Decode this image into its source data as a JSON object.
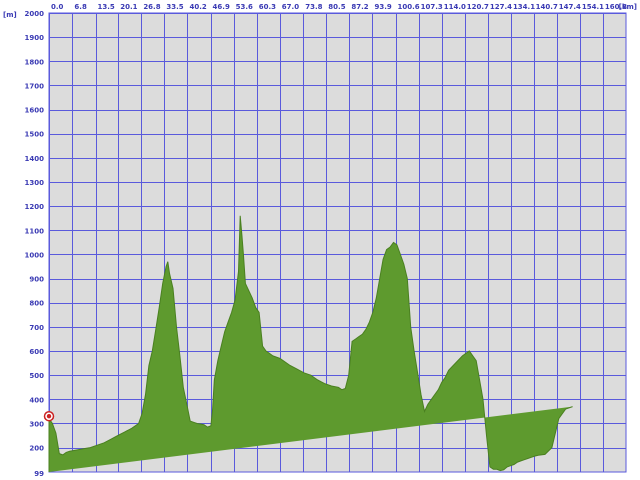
{
  "chart_data": {
    "type": "area",
    "x_unit": "[km]",
    "y_unit": "[m]",
    "ylim": [
      99,
      2000
    ],
    "xlim": [
      0,
      167.5
    ],
    "y_ticks": [
      200,
      300,
      400,
      500,
      600,
      700,
      800,
      900,
      1000,
      1100,
      1200,
      1300,
      1400,
      1500,
      1600,
      1700,
      1800,
      1900,
      2000
    ],
    "y_tick_labels": [
      "200",
      "300",
      "400",
      "500",
      "600",
      "700",
      "800",
      "900",
      "1000",
      "1100",
      "1200",
      "1300",
      "1400",
      "1500",
      "1600",
      "1700",
      "1800",
      "1900",
      "2000"
    ],
    "y_min_label": "99",
    "x_ticks": [
      0,
      6.8,
      13.5,
      20.1,
      26.8,
      33.5,
      40.2,
      46.9,
      53.6,
      60.3,
      67.0,
      73.8,
      80.5,
      87.2,
      93.9,
      100.6,
      107.3,
      114.0,
      120.7,
      127.4,
      134.1,
      140.7,
      147.4,
      154.1,
      160.8
    ],
    "x_tick_labels": [
      "0.0",
      "6.8",
      "13.5",
      "20.1",
      "26.8",
      "33.5",
      "40.2",
      "46.9",
      "53.6",
      "60.3",
      "67.0",
      "73.8",
      "80.5",
      "87.2",
      "93.9",
      "100.6",
      "107.3",
      "114.0",
      "120.7",
      "127.4",
      "134.1",
      "140.7",
      "147.4",
      "154.1",
      "160.8"
    ],
    "grid": true,
    "start_marker": {
      "x": 0,
      "y": 330
    },
    "colors": {
      "plot_bg": "#dcdcdc",
      "grid": "#5a5adc",
      "fill": "#5e9a2e",
      "fill_edge": "#4a8020",
      "axis_text": "#3a3ab4",
      "marker": "#cc2222"
    },
    "x": [
      0,
      1,
      2,
      3,
      4,
      5,
      6,
      8,
      10,
      12,
      14,
      16,
      18,
      20,
      22,
      24,
      26,
      27,
      28,
      29,
      30,
      31,
      32,
      33,
      34,
      34.5,
      35,
      36,
      37,
      38,
      39,
      40,
      41,
      42,
      43,
      44,
      45,
      46,
      47,
      47.5,
      48,
      49,
      50,
      51,
      52,
      53,
      54,
      55,
      55.5,
      56,
      56.5,
      57,
      58,
      59,
      60,
      61,
      62,
      63,
      64,
      65,
      66,
      67,
      68,
      70,
      72,
      74,
      76,
      78,
      80,
      82,
      84,
      85,
      86,
      87,
      88,
      89,
      90,
      91,
      92,
      93,
      94,
      95,
      96,
      97,
      98,
      99,
      100,
      101,
      102,
      103,
      104,
      104.5,
      105,
      106,
      107,
      108,
      109,
      110,
      111,
      112,
      113,
      114,
      115,
      116,
      118,
      120,
      122,
      124,
      126,
      127,
      128,
      129,
      130,
      131,
      132,
      133,
      134,
      135,
      136,
      137,
      138,
      139,
      140,
      141,
      142,
      144,
      146,
      148,
      150,
      152,
      154,
      156,
      158,
      160,
      162,
      163,
      164,
      165,
      166,
      167,
      167.5
    ],
    "y": [
      320,
      300,
      260,
      175,
      170,
      180,
      185,
      190,
      195,
      200,
      210,
      220,
      235,
      250,
      265,
      280,
      300,
      340,
      420,
      540,
      600,
      690,
      780,
      880,
      950,
      970,
      920,
      860,
      700,
      580,
      450,
      380,
      310,
      305,
      300,
      298,
      295,
      285,
      290,
      360,
      480,
      560,
      620,
      680,
      720,
      760,
      810,
      930,
      1160,
      1080,
      990,
      880,
      850,
      820,
      780,
      760,
      620,
      600,
      590,
      580,
      575,
      570,
      560,
      540,
      525,
      510,
      500,
      480,
      465,
      455,
      450,
      440,
      445,
      500,
      640,
      650,
      660,
      670,
      690,
      720,
      760,
      820,
      900,
      980,
      1020,
      1030,
      1050,
      1040,
      1000,
      960,
      900,
      800,
      700,
      600,
      510,
      420,
      350,
      380,
      400,
      420,
      440,
      470,
      490,
      520,
      550,
      580,
      600,
      560,
      400,
      250,
      120,
      110,
      110,
      105,
      108,
      120,
      125,
      130,
      140,
      145,
      150,
      155,
      160,
      165,
      168,
      172,
      200,
      320,
      360,
      370
    ]
  }
}
